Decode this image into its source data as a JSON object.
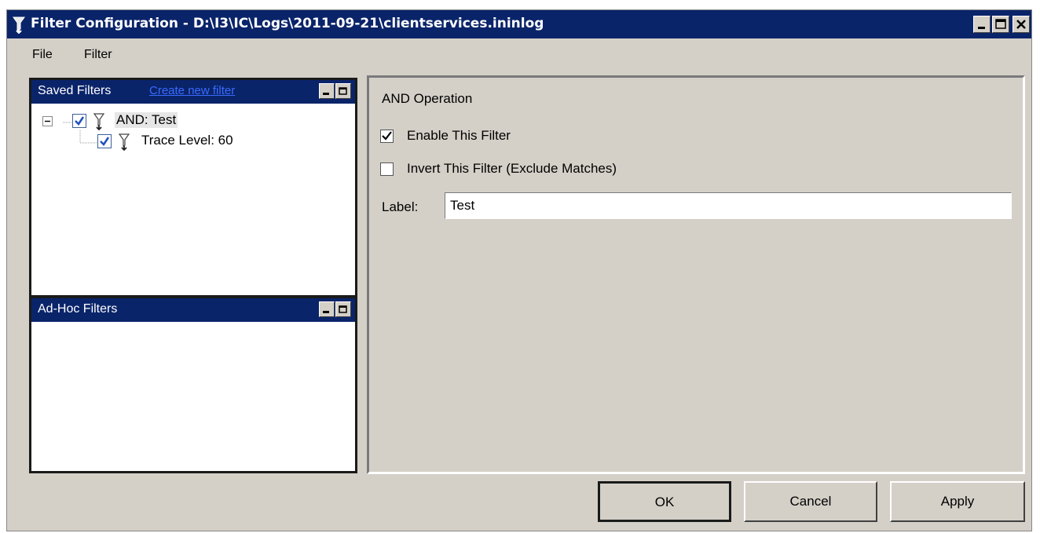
{
  "window": {
    "title": "Filter Configuration - D:\\I3\\IC\\Logs\\2011-09-21\\clientservices.ininlog"
  },
  "menu": {
    "file": "File",
    "filter": "Filter"
  },
  "saved_filters": {
    "title": "Saved Filters",
    "link": "Create new filter",
    "tree": [
      {
        "label": "AND: Test",
        "checked": true,
        "selected": true
      },
      {
        "label": "Trace Level: 60",
        "checked": true
      }
    ]
  },
  "adhoc_filters": {
    "title": "Ad-Hoc Filters"
  },
  "detail": {
    "heading": "AND Operation",
    "enable_label": "Enable This Filter",
    "enable_checked": true,
    "invert_label": "Invert This Filter (Exclude Matches)",
    "invert_checked": false,
    "label_caption": "Label:",
    "label_value": "Test"
  },
  "buttons": {
    "ok": "OK",
    "cancel": "Cancel",
    "apply": "Apply"
  },
  "colors": {
    "titlebar": "#0a246a",
    "face": "#d4d0c8",
    "link": "#3a6bff"
  },
  "icons": [
    "filter-icon",
    "minimize-icon",
    "maximize-icon",
    "close-icon",
    "collapse-icon",
    "checkmark-icon"
  ]
}
